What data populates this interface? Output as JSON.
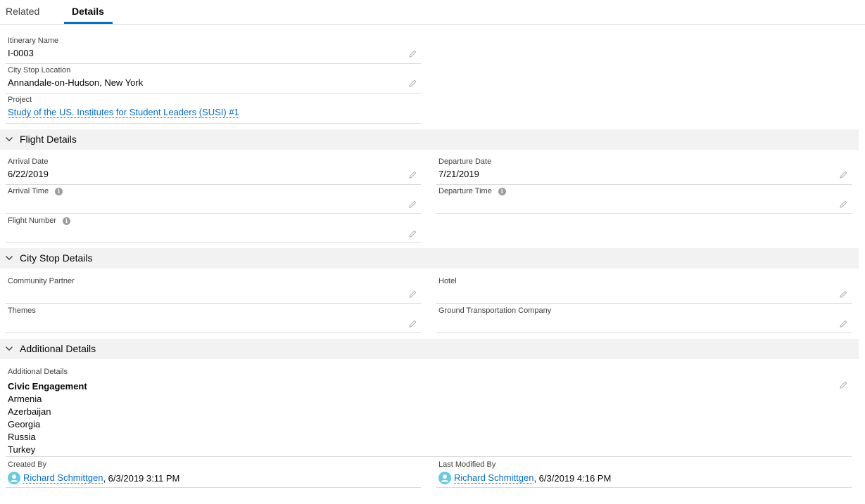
{
  "tabs": {
    "related": "Related",
    "details": "Details"
  },
  "top_fields": {
    "itinerary_name": {
      "label": "Itinerary Name",
      "value": "I-0003"
    },
    "city_stop_location": {
      "label": "City Stop Location",
      "value": "Annandale-on-Hudson, New York"
    },
    "project": {
      "label": "Project",
      "value": "Study of the US. Institutes for Student Leaders (SUSI) #1"
    }
  },
  "flight": {
    "title": "Flight Details",
    "arrival_date": {
      "label": "Arrival Date",
      "value": "6/22/2019"
    },
    "departure_date": {
      "label": "Departure Date",
      "value": "7/21/2019"
    },
    "arrival_time": {
      "label": "Arrival Time",
      "value": ""
    },
    "departure_time": {
      "label": "Departure Time",
      "value": ""
    },
    "flight_number": {
      "label": "Flight Number",
      "value": ""
    }
  },
  "city_stop": {
    "title": "City Stop Details",
    "community_partner": {
      "label": "Community Partner",
      "value": ""
    },
    "hotel": {
      "label": "Hotel",
      "value": ""
    },
    "themes": {
      "label": "Themes",
      "value": ""
    },
    "ground_transportation": {
      "label": "Ground Transportation Company",
      "value": ""
    }
  },
  "additional": {
    "title": "Additional Details",
    "details_label": "Additional Details",
    "heading": "Civic Engagement",
    "lines": [
      "Armenia",
      "Azerbaijan",
      "Georgia",
      "Russia",
      "Turkey"
    ],
    "created_by": {
      "label": "Created By",
      "user": "Richard Schmittgen",
      "date": ", 6/3/2019 3:11 PM"
    },
    "last_modified_by": {
      "label": "Last Modified By",
      "user": "Richard Schmittgen",
      "date": ", 6/3/2019 4:16 PM"
    }
  },
  "icons": {
    "edit": "pencil-icon",
    "info": "info-icon",
    "chevron": "chevron-down-icon",
    "avatar": "user-avatar-icon"
  },
  "colors": {
    "link": "#006dcc",
    "tab_active": "#0070d2",
    "section_bg": "#f3f2f2",
    "avatar": "#65cae4"
  }
}
